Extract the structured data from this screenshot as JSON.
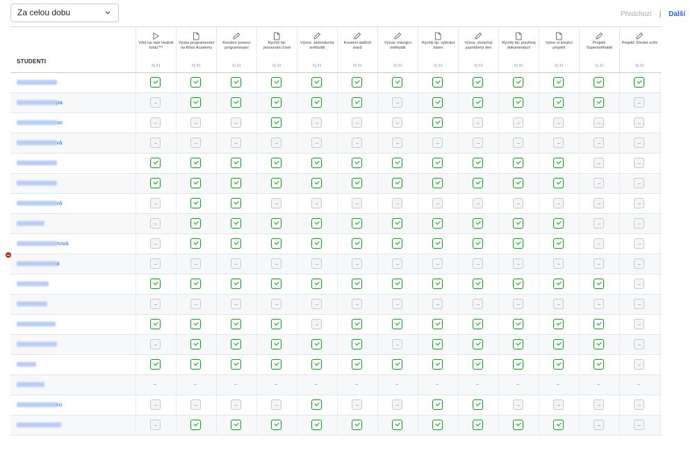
{
  "toolbar": {
    "period_select": "Za celou dobu",
    "prev_label": "Předchozí",
    "separator": "|",
    "next_label": "Další"
  },
  "table": {
    "students_header": "STUDENTI",
    "columns": [
      {
        "title": "Vítej na naší Hodině kódu™!",
        "date": "říj 31",
        "icon": "play-icon"
      },
      {
        "title": "Výuka programování na Khan Academy",
        "date": "říj 31",
        "icon": "document-icon"
      },
      {
        "title": "Kreslení pomocí programování",
        "date": "říj 31",
        "icon": "pencil-icon"
      },
      {
        "title": "Rychlý tip: posouvání čísel",
        "date": "říj 31",
        "icon": "document-icon"
      },
      {
        "title": "Výzva: Jednoduchý sněhulák",
        "date": "říj 31",
        "icon": "pencil-icon"
      },
      {
        "title": "Kreslení dalších tvarů",
        "date": "říj 31",
        "icon": "pencil-icon"
      },
      {
        "title": "Výzva: mávající sněhulák",
        "date": "říj 31",
        "icon": "pencil-icon"
      },
      {
        "title": "Rychlý tip: vybírání barev",
        "date": "říj 31",
        "icon": "document-icon"
      },
      {
        "title": "Výzva: slunečný zasněžený den",
        "date": "říj 31",
        "icon": "pencil-icon"
      },
      {
        "title": "Rychlý tip: používej dokumentaci!",
        "date": "říj 31",
        "icon": "document-icon"
      },
      {
        "title": "Vyber si kreslicí projekt!",
        "date": "říj 31",
        "icon": "document-icon"
      },
      {
        "title": "Projekt: Supersněhulák",
        "date": "říj 31",
        "icon": "pencil-icon"
      },
      {
        "title": "Projekt: Divoké zvíře",
        "date": "říj 31",
        "icon": "pencil-icon"
      }
    ],
    "rows": [
      {
        "name_suffix": "",
        "status": "DDDDDDDDDDDDD"
      },
      {
        "name_suffix": "pa",
        "status": "NDDDDDNDDDDDN"
      },
      {
        "name_suffix": "on",
        "status": "NNNDNNNDNNNNN"
      },
      {
        "name_suffix": "vá",
        "status": "NNNNNNNNNNNNN"
      },
      {
        "name_suffix": "",
        "status": "DDDDDDDDDDDNN"
      },
      {
        "name_suffix": "",
        "status": "DDDDDDDDDDDNN"
      },
      {
        "name_suffix": "vá",
        "status": "NDDNNNNNNNNNN"
      },
      {
        "name_suffix": "",
        "status": "NDDDDDDDDDDNN"
      },
      {
        "name_suffix": "nová",
        "status": "NDDDDDDDDDDNN"
      },
      {
        "name_suffix": "á",
        "status": "NNNNNNNNNNNNN"
      },
      {
        "name_suffix": "",
        "status": "DDDDDDDDDDDDN"
      },
      {
        "name_suffix": "",
        "status": "NNNNNNNNNNNNN"
      },
      {
        "name_suffix": "",
        "status": "DDDDNDDDDDDDN"
      },
      {
        "name_suffix": "",
        "status": "NDDDDDNDDDDDN"
      },
      {
        "name_suffix": "",
        "status": "DDDDDDDDDDDDN"
      },
      {
        "name_suffix": "",
        "status": "-------------"
      },
      {
        "name_suffix": "ko",
        "status": "NNNNDNNDDNNNN"
      },
      {
        "name_suffix": "",
        "status": "NDDDDDDDDDDNN"
      }
    ],
    "warning_icon": "minus-circle-icon"
  },
  "colors": {
    "accent": "#1865f2",
    "completed": "#00a60e",
    "not_started": "#c6c8cb",
    "warning": "#d92916"
  }
}
